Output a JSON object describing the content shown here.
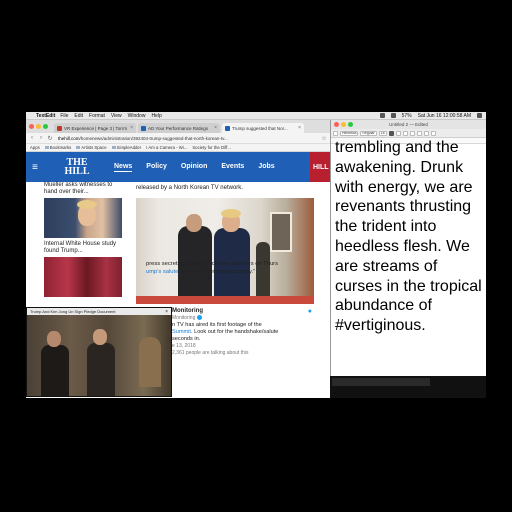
{
  "menubar": {
    "app": "TextEdit",
    "items": [
      "File",
      "Edit",
      "Format",
      "View",
      "Window",
      "Help"
    ],
    "battery": "57%",
    "clock": "Sat Jun 16  12:00:58 AM"
  },
  "browser": {
    "tabs": [
      {
        "title": "VR Experience | Page 3 | Tom's",
        "favicon_color": "#c0392b"
      },
      {
        "title": "AD Your Performance Ratings",
        "favicon_color": "#1f5fb5"
      },
      {
        "title": "Trump suggested that Nor...",
        "favicon_color": "#1f5fb5",
        "active": true
      }
    ],
    "url_prefix": "thehill.com",
    "url_rest": "/homenews/administration/392404-trump-suggested-that-north-korean-tv...",
    "bookmarks": [
      "Apps",
      "Bookmarks",
      "Artists Space",
      "SimpleAdder",
      "I Am a Camera - Wi...",
      "Society for the Diff..."
    ]
  },
  "hill": {
    "logo_line1": "THE",
    "logo_line2": "HILL",
    "nav": [
      "News",
      "Policy",
      "Opinion",
      "Events",
      "Jobs"
    ],
    "active_nav": "News",
    "tv_label": "HILL",
    "sidebar": [
      {
        "headline": "Mueller asks witnesses to hand over their..."
      },
      {
        "headline": "Internal White House study found Trump..."
      }
    ],
    "caption": "released by a North Korean TV network.",
    "tweet": {
      "handle": "Monitoring",
      "sub": "Monitoring",
      "line1": "n TV has aired its first footage of the",
      "line2_link": "Summit",
      "line2_rest": ". Look out for the handshake/salute",
      "line3": "seconds in.",
      "date": "e 13, 2018",
      "likes": "2,361 people are talking about this"
    },
    "body_line1": "press secretary Sarah Huckabee Sanders on Thurs",
    "body_line2_link": "ump's salute",
    "body_line2_rest": ", calling it \"common courtesy.\""
  },
  "pip": {
    "title": "Trump And Kim Jong Un Sign Pledge Document"
  },
  "textedit": {
    "title": "Untitled 2 — Edited",
    "font": "Helvetica",
    "style": "Regular",
    "size": "18",
    "text": "trembling and the awakening. Drunk with energy, we are revenants thrusting the trident into heedless flesh. We are streams of curses in the tropical abundance of #vertiginous."
  }
}
